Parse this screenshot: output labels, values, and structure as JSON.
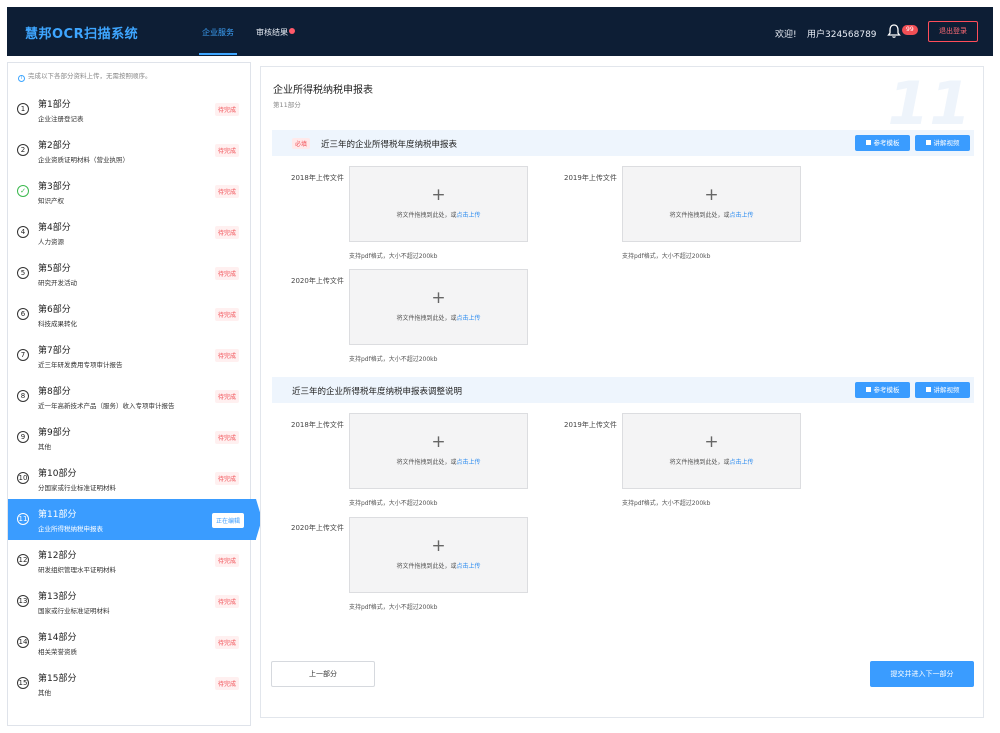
{
  "header": {
    "brand": "慧邦OCR扫描系统",
    "tabs": [
      {
        "label": "企业服务",
        "active": true
      },
      {
        "label": "审核结果",
        "active": false,
        "dot": true
      }
    ],
    "welcome": "欢迎!",
    "user": "用户324568789",
    "notification_count": "99",
    "logout_label": "退出登录",
    "accent_color": "#3ea6ff"
  },
  "sidebar": {
    "tip": "完成以下各部分资料上传，无需按照顺序。",
    "items": [
      {
        "num": "1",
        "title": "第1部分",
        "sub": "企业注册登记表",
        "status": "待完成"
      },
      {
        "num": "2",
        "title": "第2部分",
        "sub": "企业资质证明材料（营业执照）",
        "status": "待完成"
      },
      {
        "num": "✓",
        "title": "第3部分",
        "sub": "知识产权",
        "status": "待完成",
        "done": true
      },
      {
        "num": "4",
        "title": "第4部分",
        "sub": "人力资源",
        "status": "待完成"
      },
      {
        "num": "5",
        "title": "第5部分",
        "sub": "研究开发活动",
        "status": "待完成"
      },
      {
        "num": "6",
        "title": "第6部分",
        "sub": "科技成果转化",
        "status": "待完成"
      },
      {
        "num": "7",
        "title": "第7部分",
        "sub": "近三年研发费用专项审计报告",
        "status": "待完成"
      },
      {
        "num": "8",
        "title": "第8部分",
        "sub": "近一年高新技术产品（服务）收入专项审计报告",
        "status": "待完成"
      },
      {
        "num": "9",
        "title": "第9部分",
        "sub": "其他",
        "status": "待完成"
      },
      {
        "num": "10",
        "title": "第10部分",
        "sub": "分国家或行业标准证明材料",
        "status": "待完成"
      },
      {
        "num": "11",
        "title": "第11部分",
        "sub": "企业所得税纳税申报表",
        "status": "正在编辑",
        "active": true
      },
      {
        "num": "12",
        "title": "第12部分",
        "sub": "研发组织管理水平证明材料",
        "status": "待完成"
      },
      {
        "num": "13",
        "title": "第13部分",
        "sub": "国家或行业标准证明材料",
        "status": "待完成"
      },
      {
        "num": "14",
        "title": "第14部分",
        "sub": "相关荣誉资质",
        "status": "待完成"
      },
      {
        "num": "15",
        "title": "第15部分",
        "sub": "其他",
        "status": "待完成"
      }
    ]
  },
  "main": {
    "title": "企业所得税纳税申报表",
    "subtitle": "第11部分",
    "watermark": "11",
    "template_label": "参考模板",
    "video_label": "讲解视频",
    "upload_hint_prefix": "将文件拖拽到此处，或",
    "upload_hint_link": "点击上传",
    "upload_note": "支持pdf格式，大小不超过200kb",
    "sections": [
      {
        "required_label": "必填",
        "title": "近三年的企业所得税年度纳税申报表",
        "uploads": [
          "2018年上传文件",
          "2019年上传文件",
          "2020年上传文件"
        ]
      },
      {
        "title": "近三年的企业所得税年度纳税申报表调整说明",
        "uploads": [
          "2018年上传文件",
          "2019年上传文件",
          "2020年上传文件"
        ]
      }
    ],
    "prev_label": "上一部分",
    "next_label": "提交并进入下一部分"
  }
}
